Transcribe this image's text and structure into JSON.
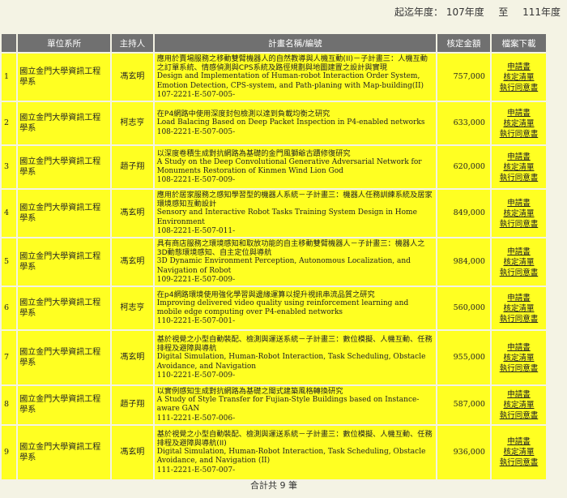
{
  "year_range": {
    "label": "起迄年度：",
    "start": "107年度",
    "separator": "至",
    "end": "111年度"
  },
  "table": {
    "headers": [
      "單位系所",
      "主持人",
      "計畫名稱/編號",
      "核定金額",
      "檔案下載"
    ],
    "download_links": [
      "申請書",
      "核定清單",
      "執行同意書"
    ],
    "rows": [
      {
        "index": "1",
        "unit": "國立金門大學資訊工程學系",
        "pi": "馮玄明",
        "title_zh": "應用於賣場服務之移動雙臂機器人的自然教導與人機互動(II)－子計畫三：人機互動之訂單系統、情感偵測與CPS系統及路徑規劃與地圖建置之設計與實現",
        "title_en": "Design and Implementation of Human-robot Interaction Order System, Emotion Detection, CPS-system, and Path-planing with Map-building(II)",
        "code": "107-2221-E-507-005-",
        "amount": "757,000"
      },
      {
        "index": "2",
        "unit": "國立金門大學資訊工程學系",
        "pi": "柯志亨",
        "title_zh": "在P4網路中使用深度封包檢測以達到負載均衡之研究",
        "title_en": "Load Balacing Based on Deep Packet Inspection in P4-enabled networks",
        "code": "108-2221-E-507-005-",
        "amount": "633,000"
      },
      {
        "index": "3",
        "unit": "國立金門大學資訊工程學系",
        "pi": "趙子翔",
        "title_zh": "以深度卷積生成對抗網路為基礎的金門風獅爺古蹟修復研究",
        "title_en": "A Study on the Deep Convolutional Generative Adversarial Network for Monuments Restoration of Kinmen Wind Lion God",
        "code": "108-2221-E-507-009-",
        "amount": "620,000"
      },
      {
        "index": "4",
        "unit": "國立金門大學資訊工程學系",
        "pi": "馮玄明",
        "title_zh": "應用於居家服務之感知學習型的機器人系統－子計畫三：機器人任務訓練系統及居家環境感知互動設計",
        "title_en": "Sensory and Interactive Robot Tasks Training System Design in Home Environment",
        "code": "108-2221-E-507-011-",
        "amount": "849,000"
      },
      {
        "index": "5",
        "unit": "國立金門大學資訊工程學系",
        "pi": "馮玄明",
        "title_zh": "具有商店服務之環境感知和取放功能的自主移動雙臂機器人－子計畫三：機器人之3D動態環境感知、自主定位與導航",
        "title_en": "3D Dynamic Environment Perception, Autonomous Localization, and Navigation of Robot",
        "code": "109-2221-E-507-009-",
        "amount": "984,000"
      },
      {
        "index": "6",
        "unit": "國立金門大學資訊工程學系",
        "pi": "柯志亨",
        "title_zh": "在p4網路環境使用強化學習與邊緣運算以提升視訊串流品質之研究",
        "title_en": "Improving delivered video quality using reinforcement learning and mobile edge computing over P4-enabled networks",
        "code": "110-2221-E-507-001-",
        "amount": "560,000"
      },
      {
        "index": "7",
        "unit": "國立金門大學資訊工程學系",
        "pi": "馮玄明",
        "title_zh": "基於視覺之小型自動裝配、檢測與運送系統－子計畫三：數位模擬、人機互動、任務排程及避障與導航",
        "title_en": "Digital Simulation, Human-Robot Interaction, Task Scheduling, Obstacle Avoidance, and Navigation",
        "code": "110-2221-E-507-009-",
        "amount": "955,000"
      },
      {
        "index": "8",
        "unit": "國立金門大學資訊工程學系",
        "pi": "趙子翔",
        "title_zh": "以實例感知生成對抗網路為基礎之閩式建築風格轉換研究",
        "title_en": "A Study of Style Transfer for Fujian-Style Buildings based on Instance-aware GAN",
        "code": "111-2221-E-507-006-",
        "amount": "587,000"
      },
      {
        "index": "9",
        "unit": "國立金門大學資訊工程學系",
        "pi": "馮玄明",
        "title_zh": "基於視覺之小型自動裝配、檢測與運送系統－子計畫三：數位模擬、人機互動、任務排程及避障與導航(II)",
        "title_en": "Digital Simulation, Human-Robot Interaction, Task Scheduling, Obstacle Avoidance, and Navigation (II)",
        "code": "111-2221-E-507-007-",
        "amount": "936,000"
      }
    ]
  },
  "footer": {
    "total_text": "合計共 9 筆"
  }
}
